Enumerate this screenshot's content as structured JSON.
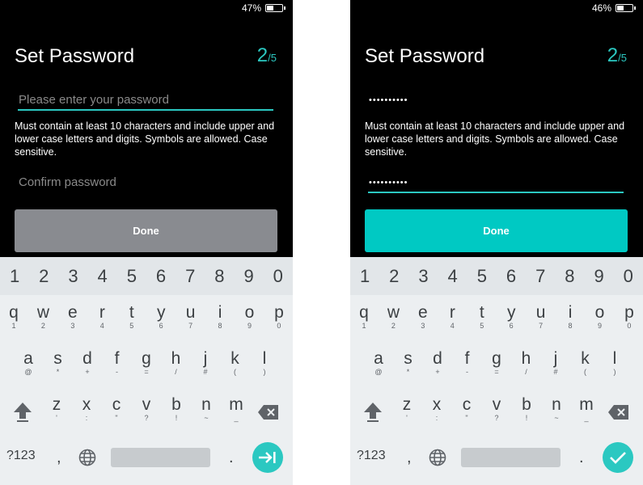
{
  "left": {
    "status": {
      "battery": "47%",
      "battery_level": 0.47
    },
    "title": "Set Password",
    "step_current": "2",
    "step_total": "/5",
    "password_placeholder": "Please enter your password",
    "hint": "Must contain at least 10 characters and include upper and lower case letters and digits. Symbols are allowed. Case sensitive.",
    "confirm_placeholder": "Confirm password",
    "done_label": "Done"
  },
  "right": {
    "status": {
      "battery": "46%",
      "battery_level": 0.46
    },
    "title": "Set Password",
    "step_current": "2",
    "step_total": "/5",
    "password_value": "••••••••••",
    "hint": "Must contain at least 10 characters and include upper and lower case letters and digits. Symbols are allowed. Case sensitive.",
    "confirm_value": "••••••••••",
    "done_label": "Done"
  },
  "keyboard": {
    "numbers": [
      "1",
      "2",
      "3",
      "4",
      "5",
      "6",
      "7",
      "8",
      "9",
      "0"
    ],
    "row1": [
      [
        "q",
        "1"
      ],
      [
        "w",
        "2"
      ],
      [
        "e",
        "3"
      ],
      [
        "r",
        "4"
      ],
      [
        "t",
        "5"
      ],
      [
        "y",
        "6"
      ],
      [
        "u",
        "7"
      ],
      [
        "i",
        "8"
      ],
      [
        "o",
        "9"
      ],
      [
        "p",
        "0"
      ]
    ],
    "row2": [
      [
        "a",
        "@"
      ],
      [
        "s",
        "*"
      ],
      [
        "d",
        "+"
      ],
      [
        "f",
        "-"
      ],
      [
        "g",
        "="
      ],
      [
        "h",
        "/"
      ],
      [
        "j",
        "#"
      ],
      [
        "k",
        "("
      ],
      [
        "l",
        ")"
      ]
    ],
    "row3": [
      [
        "z",
        "'"
      ],
      [
        "x",
        ":"
      ],
      [
        "c",
        "\""
      ],
      [
        "v",
        "?"
      ],
      [
        "b",
        "!"
      ],
      [
        "n",
        "~"
      ],
      [
        "m",
        "_"
      ]
    ],
    "sym_label": "?123",
    "comma": ",",
    "period": "."
  },
  "colors": {
    "accent": "#2bc8c1",
    "done_enabled": "#00c9c3",
    "done_disabled": "#898b90"
  },
  "icons": {
    "shift": "shift-icon",
    "backspace": "backspace-icon",
    "globe": "globe-icon",
    "tab_enter": "tab-next-icon",
    "done_enter": "checkmark-icon"
  }
}
